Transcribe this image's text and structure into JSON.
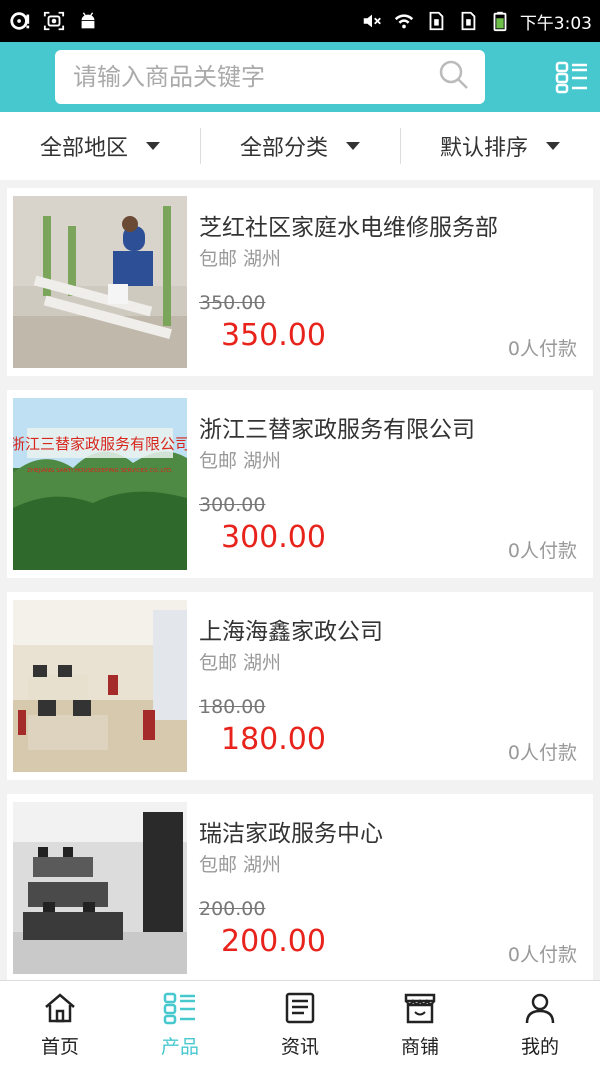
{
  "status_bar": {
    "time": "下午3:03",
    "icons": [
      "sync-icon",
      "screenshot-icon",
      "android-icon",
      "mute-icon",
      "wifi-icon",
      "sim1-icon",
      "sim2-icon",
      "battery-icon"
    ]
  },
  "header": {
    "search_placeholder": "请输入商品关键字",
    "search_icon": "search-icon",
    "menu_icon": "list-grid-icon",
    "accent_color": "#47c8cf"
  },
  "filters": [
    {
      "label": "全部地区"
    },
    {
      "label": "全部分类"
    },
    {
      "label": "默认排序"
    }
  ],
  "products": [
    {
      "title": "芝红社区家庭水电维修服务部",
      "shipping": "包邮 湖州",
      "old_price": "350.00",
      "price": "350.00",
      "paid": "0人付款"
    },
    {
      "title": "浙江三替家政服务有限公司",
      "shipping": "包邮 湖州",
      "old_price": "300.00",
      "price": "300.00",
      "paid": "0人付款",
      "image_text": "浙江三替家政服务有限公司",
      "image_subtext": "ZHEJIANG SANTI HOUSEKEEPING SERVICES CO.,LTD."
    },
    {
      "title": "上海海鑫家政公司",
      "shipping": "包邮 湖州",
      "old_price": "180.00",
      "price": "180.00",
      "paid": "0人付款"
    },
    {
      "title": "瑞洁家政服务中心",
      "shipping": "包邮 湖州",
      "old_price": "200.00",
      "price": "200.00",
      "paid": "0人付款"
    }
  ],
  "price_color": "#e8231b",
  "bottom_nav": [
    {
      "label": "首页",
      "icon": "home-icon"
    },
    {
      "label": "产品",
      "icon": "product-list-icon",
      "active": true
    },
    {
      "label": "资讯",
      "icon": "news-icon"
    },
    {
      "label": "商铺",
      "icon": "store-icon"
    },
    {
      "label": "我的",
      "icon": "user-icon"
    }
  ]
}
